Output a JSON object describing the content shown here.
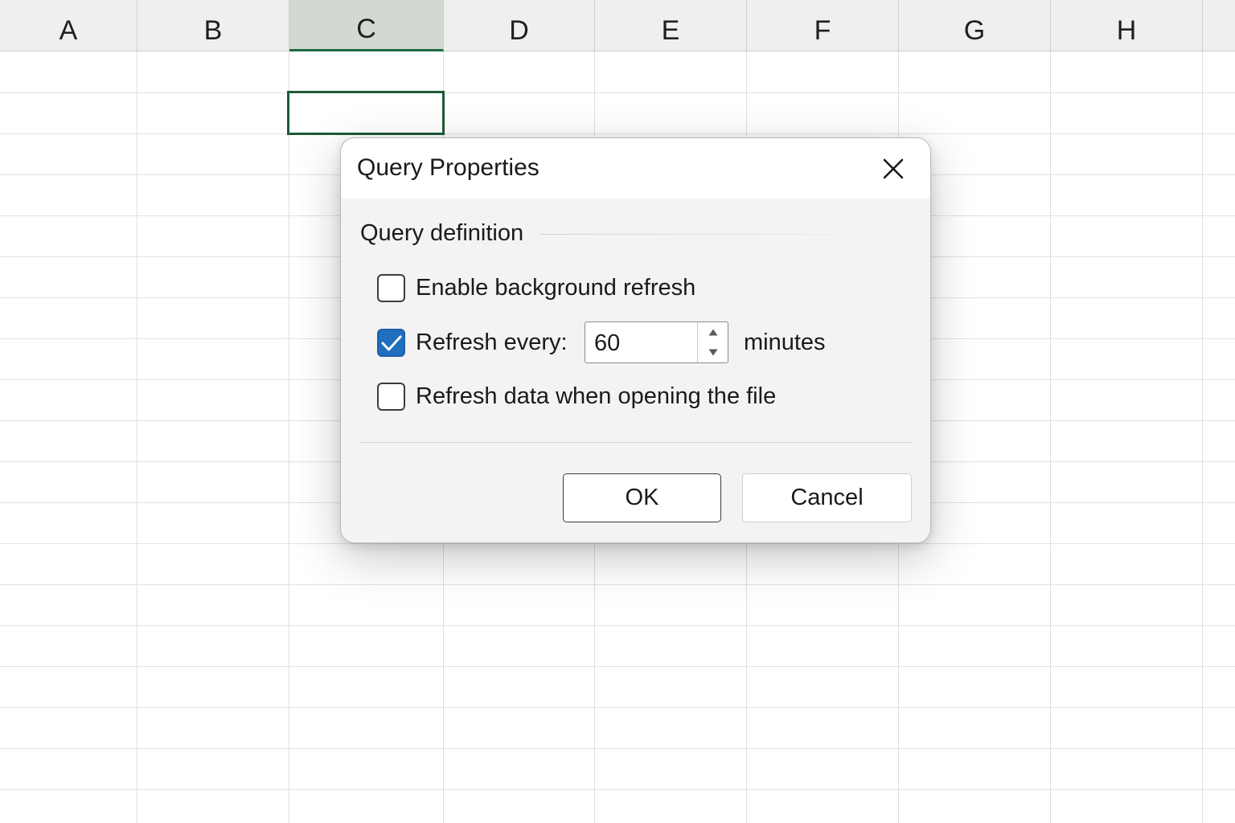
{
  "sheet": {
    "columns": [
      "A",
      "B",
      "C",
      "D",
      "E",
      "F",
      "G",
      "H"
    ],
    "selected_column": "C"
  },
  "dialog": {
    "title": "Query Properties",
    "close_icon": "close-icon",
    "section_label": "Query definition",
    "options": {
      "background_refresh": {
        "label": "Enable background refresh",
        "checked": false
      },
      "refresh_every": {
        "label": "Refresh every:",
        "checked": true,
        "value": "60",
        "unit": "minutes"
      },
      "refresh_on_open": {
        "label": "Refresh data when opening the file",
        "checked": false
      }
    },
    "ok_label": "OK",
    "cancel_label": "Cancel",
    "accent_color": "#1f6fbf",
    "selection_color": "#1e6b3c"
  }
}
